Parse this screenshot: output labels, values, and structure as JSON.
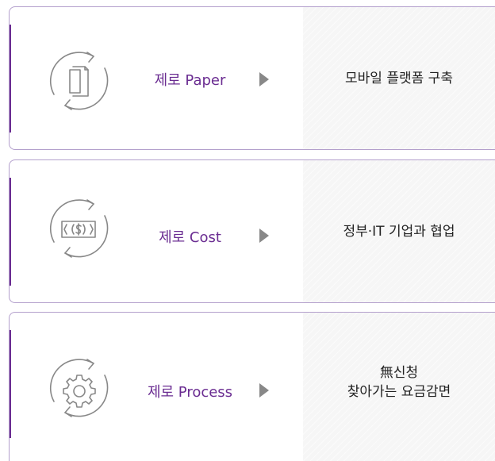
{
  "cards": [
    {
      "title": "제로 Paper",
      "icon": "paper-icon",
      "description": [
        "모바일 플랫폼 구축"
      ]
    },
    {
      "title": "제로 Cost",
      "icon": "money-icon",
      "description": [
        "정부·IT 기업과 협업"
      ]
    },
    {
      "title": "제로 Process",
      "icon": "gear-icon",
      "description": [
        "無신청",
        "찾아가는 요금감면"
      ]
    }
  ],
  "colors": {
    "accent": "#6a2c91",
    "border": "#b39fcc",
    "icon": "#888888",
    "panel": "#f6f6f6"
  }
}
